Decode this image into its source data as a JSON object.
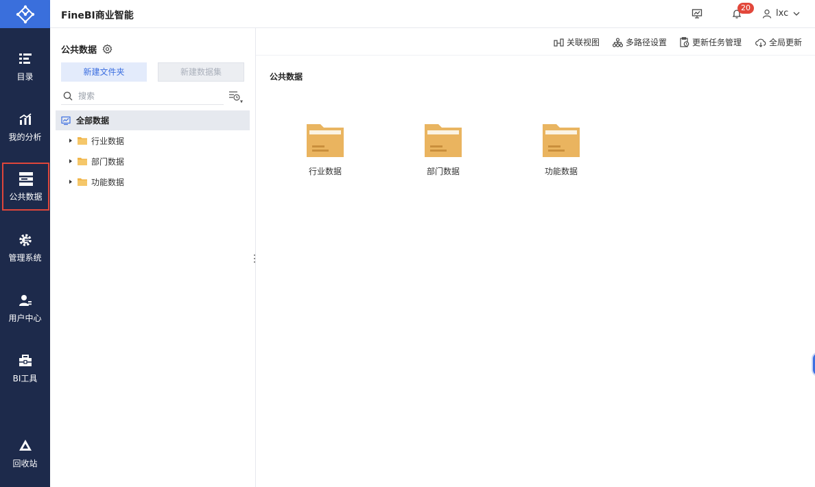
{
  "app": {
    "title": "FineBI商业智能"
  },
  "header": {
    "notification_count": "20",
    "user_name": "lxc"
  },
  "nav": {
    "items": [
      {
        "label": "目录",
        "icon": "catalog-icon"
      },
      {
        "label": "我的分析",
        "icon": "analysis-icon"
      },
      {
        "label": "公共数据",
        "icon": "public-data-icon",
        "active": true
      },
      {
        "label": "管理系统",
        "icon": "gear-icon"
      },
      {
        "label": "用户中心",
        "icon": "user-center-icon"
      },
      {
        "label": "BI工具",
        "icon": "toolbox-icon"
      },
      {
        "label": "回收站",
        "icon": "recycle-bin-icon"
      }
    ]
  },
  "panel": {
    "title": "公共数据",
    "new_folder_label": "新建文件夹",
    "new_dataset_label": "新建数据集",
    "search_placeholder": "搜索",
    "tree": {
      "root_label": "全部数据",
      "items": [
        {
          "label": "行业数据"
        },
        {
          "label": "部门数据"
        },
        {
          "label": "功能数据"
        }
      ]
    }
  },
  "toolbar": {
    "relation_view": "关联视图",
    "multipath_settings": "多路径设置",
    "update_task_mgmt": "更新任务管理",
    "global_update": "全局更新"
  },
  "main": {
    "breadcrumb": "公共数据",
    "folders": [
      {
        "name": "行业数据"
      },
      {
        "name": "部门数据"
      },
      {
        "name": "功能数据"
      }
    ]
  },
  "colors": {
    "nav_bg": "#1d2a4b",
    "logo_bg": "#3a6fdc",
    "accent": "#3b6ee0",
    "active_outline": "#e0463a",
    "folder": "#e9b561",
    "badge": "#e2473b"
  }
}
